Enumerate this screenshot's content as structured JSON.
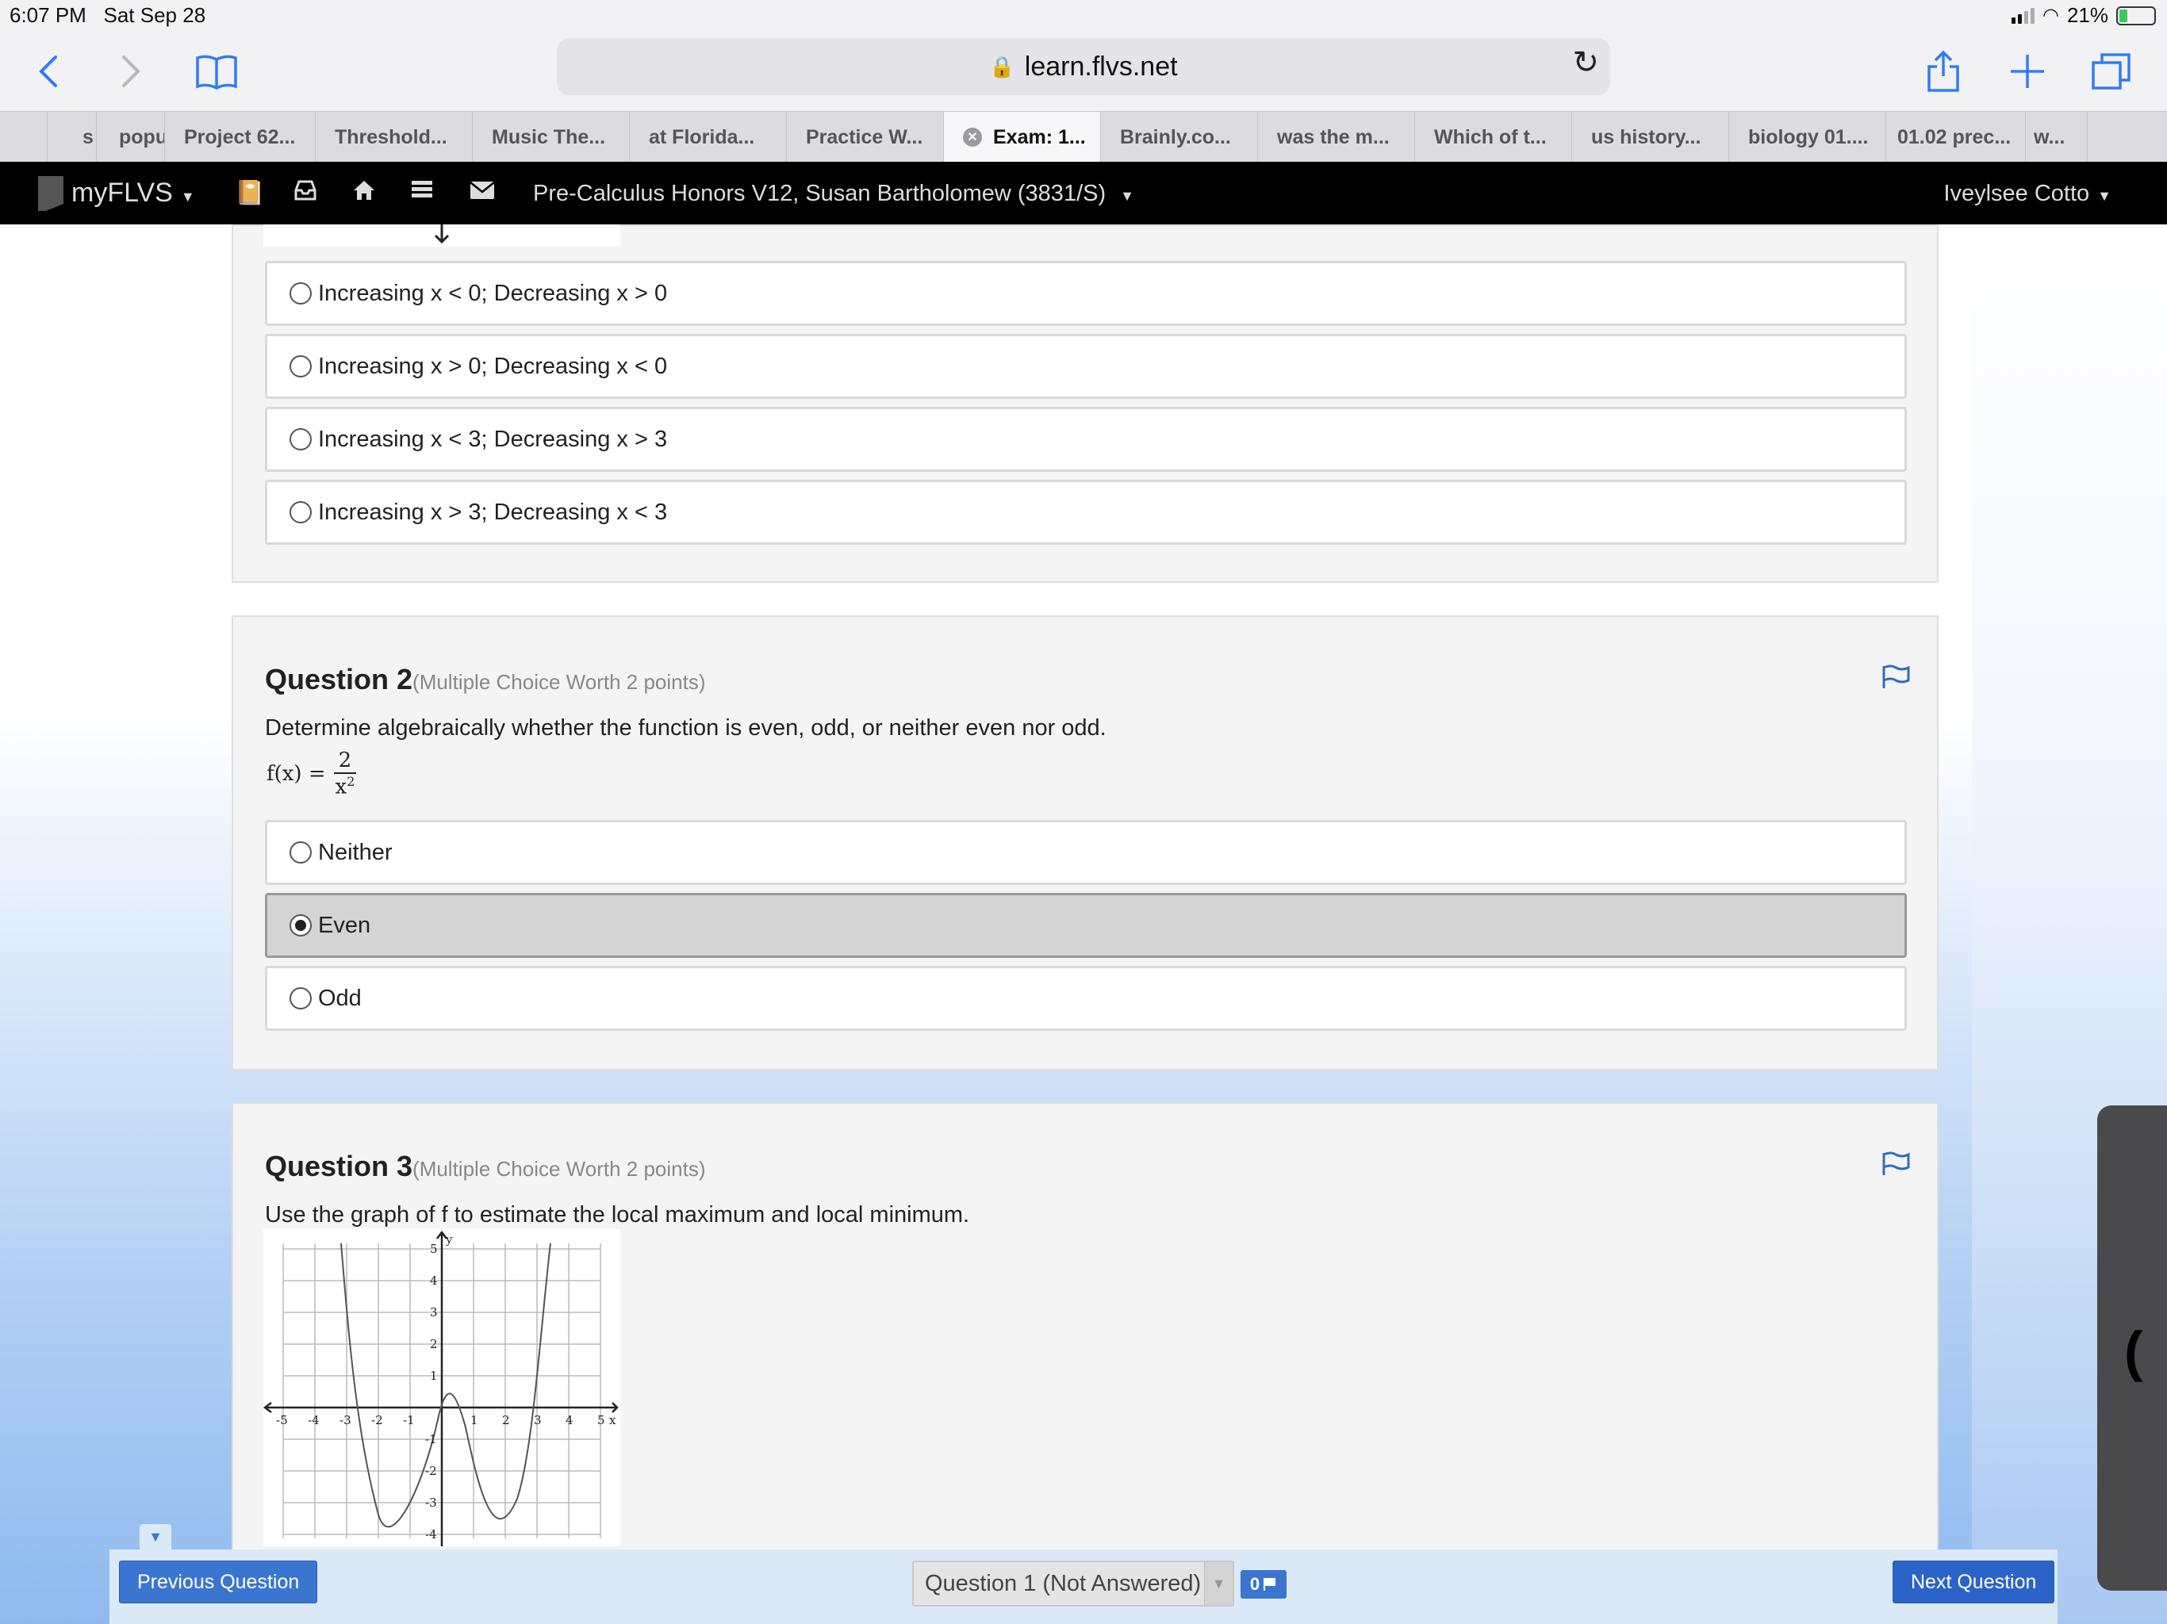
{
  "status_bar": {
    "time": "6:07 PM",
    "date": "Sat Sep 28",
    "battery": "21%"
  },
  "browser": {
    "url": "learn.flvs.net",
    "tabs": [
      {
        "label": "s",
        "active": false
      },
      {
        "label": "popu",
        "active": false
      },
      {
        "label": "Project 62...",
        "active": false
      },
      {
        "label": "Threshold...",
        "active": false
      },
      {
        "label": "Music The...",
        "active": false
      },
      {
        "label": "at Florida...",
        "active": false
      },
      {
        "label": "Practice W...",
        "active": false
      },
      {
        "label": "Exam: 1...",
        "active": true
      },
      {
        "label": "Brainly.co...",
        "active": false
      },
      {
        "label": "was the m...",
        "active": false
      },
      {
        "label": "Which of t...",
        "active": false
      },
      {
        "label": "us history...",
        "active": false
      },
      {
        "label": "biology 01....",
        "active": false
      },
      {
        "label": "01.02 prec...",
        "active": false
      },
      {
        "label": "w...",
        "active": false
      }
    ]
  },
  "site_nav": {
    "logo": "myFLVS",
    "course": "Pre-Calculus Honors V12, Susan Bartholomew (3831/S)",
    "user": "Iveylsee Cotto"
  },
  "question1": {
    "options": [
      "Increasing x < 0; Decreasing x > 0",
      "Increasing x > 0; Decreasing x < 0",
      "Increasing x < 3; Decreasing x > 3",
      "Increasing x > 3; Decreasing x < 3"
    ]
  },
  "question2": {
    "title": "Question 2",
    "meta": "(Multiple Choice Worth 2 points)",
    "text": "Determine algebraically whether the function is even, odd, or neither even nor odd.",
    "formula": {
      "lhs": "f(x) =",
      "numerator": "2",
      "denominator": "x",
      "exponent": "2"
    },
    "options": [
      {
        "label": "Neither",
        "selected": false
      },
      {
        "label": "Even",
        "selected": true
      },
      {
        "label": "Odd",
        "selected": false
      }
    ]
  },
  "question3": {
    "title": "Question 3",
    "meta": "(Multiple Choice Worth 2 points)",
    "text": "Use the graph of f to estimate the local maximum and local minimum.",
    "graph": {
      "x_label": "x",
      "y_label": "y",
      "x_ticks": [
        "-5",
        "-4",
        "-3",
        "-2",
        "-1",
        "1",
        "2",
        "3",
        "4",
        "5"
      ],
      "y_ticks_pos": [
        "1",
        "2",
        "3",
        "4",
        "5"
      ],
      "y_ticks_neg": [
        "-1",
        "-2",
        "-3",
        "-4"
      ]
    }
  },
  "bottom_bar": {
    "previous": "Previous Question",
    "question_select": "Question 1 (Not Answered)",
    "flag_count": "0",
    "next": "Next Question"
  }
}
